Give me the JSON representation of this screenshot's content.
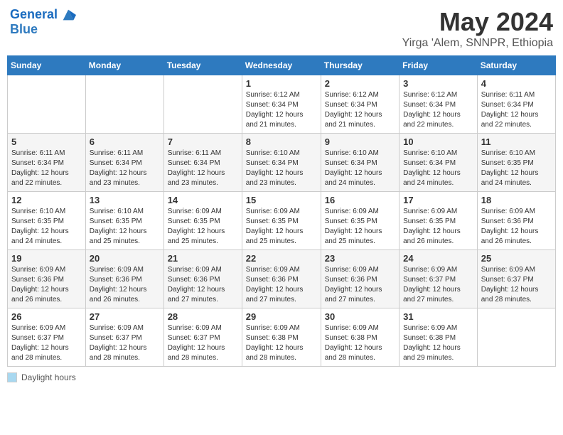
{
  "header": {
    "logo_line1": "General",
    "logo_line2": "Blue",
    "month": "May 2024",
    "location": "Yirga 'Alem, SNNPR, Ethiopia"
  },
  "days_of_week": [
    "Sunday",
    "Monday",
    "Tuesday",
    "Wednesday",
    "Thursday",
    "Friday",
    "Saturday"
  ],
  "weeks": [
    [
      {
        "day": "",
        "info": ""
      },
      {
        "day": "",
        "info": ""
      },
      {
        "day": "",
        "info": ""
      },
      {
        "day": "1",
        "info": "Sunrise: 6:12 AM\nSunset: 6:34 PM\nDaylight: 12 hours\nand 21 minutes."
      },
      {
        "day": "2",
        "info": "Sunrise: 6:12 AM\nSunset: 6:34 PM\nDaylight: 12 hours\nand 21 minutes."
      },
      {
        "day": "3",
        "info": "Sunrise: 6:12 AM\nSunset: 6:34 PM\nDaylight: 12 hours\nand 22 minutes."
      },
      {
        "day": "4",
        "info": "Sunrise: 6:11 AM\nSunset: 6:34 PM\nDaylight: 12 hours\nand 22 minutes."
      }
    ],
    [
      {
        "day": "5",
        "info": "Sunrise: 6:11 AM\nSunset: 6:34 PM\nDaylight: 12 hours\nand 22 minutes."
      },
      {
        "day": "6",
        "info": "Sunrise: 6:11 AM\nSunset: 6:34 PM\nDaylight: 12 hours\nand 23 minutes."
      },
      {
        "day": "7",
        "info": "Sunrise: 6:11 AM\nSunset: 6:34 PM\nDaylight: 12 hours\nand 23 minutes."
      },
      {
        "day": "8",
        "info": "Sunrise: 6:10 AM\nSunset: 6:34 PM\nDaylight: 12 hours\nand 23 minutes."
      },
      {
        "day": "9",
        "info": "Sunrise: 6:10 AM\nSunset: 6:34 PM\nDaylight: 12 hours\nand 24 minutes."
      },
      {
        "day": "10",
        "info": "Sunrise: 6:10 AM\nSunset: 6:34 PM\nDaylight: 12 hours\nand 24 minutes."
      },
      {
        "day": "11",
        "info": "Sunrise: 6:10 AM\nSunset: 6:35 PM\nDaylight: 12 hours\nand 24 minutes."
      }
    ],
    [
      {
        "day": "12",
        "info": "Sunrise: 6:10 AM\nSunset: 6:35 PM\nDaylight: 12 hours\nand 24 minutes."
      },
      {
        "day": "13",
        "info": "Sunrise: 6:10 AM\nSunset: 6:35 PM\nDaylight: 12 hours\nand 25 minutes."
      },
      {
        "day": "14",
        "info": "Sunrise: 6:09 AM\nSunset: 6:35 PM\nDaylight: 12 hours\nand 25 minutes."
      },
      {
        "day": "15",
        "info": "Sunrise: 6:09 AM\nSunset: 6:35 PM\nDaylight: 12 hours\nand 25 minutes."
      },
      {
        "day": "16",
        "info": "Sunrise: 6:09 AM\nSunset: 6:35 PM\nDaylight: 12 hours\nand 25 minutes."
      },
      {
        "day": "17",
        "info": "Sunrise: 6:09 AM\nSunset: 6:35 PM\nDaylight: 12 hours\nand 26 minutes."
      },
      {
        "day": "18",
        "info": "Sunrise: 6:09 AM\nSunset: 6:36 PM\nDaylight: 12 hours\nand 26 minutes."
      }
    ],
    [
      {
        "day": "19",
        "info": "Sunrise: 6:09 AM\nSunset: 6:36 PM\nDaylight: 12 hours\nand 26 minutes."
      },
      {
        "day": "20",
        "info": "Sunrise: 6:09 AM\nSunset: 6:36 PM\nDaylight: 12 hours\nand 26 minutes."
      },
      {
        "day": "21",
        "info": "Sunrise: 6:09 AM\nSunset: 6:36 PM\nDaylight: 12 hours\nand 27 minutes."
      },
      {
        "day": "22",
        "info": "Sunrise: 6:09 AM\nSunset: 6:36 PM\nDaylight: 12 hours\nand 27 minutes."
      },
      {
        "day": "23",
        "info": "Sunrise: 6:09 AM\nSunset: 6:36 PM\nDaylight: 12 hours\nand 27 minutes."
      },
      {
        "day": "24",
        "info": "Sunrise: 6:09 AM\nSunset: 6:37 PM\nDaylight: 12 hours\nand 27 minutes."
      },
      {
        "day": "25",
        "info": "Sunrise: 6:09 AM\nSunset: 6:37 PM\nDaylight: 12 hours\nand 28 minutes."
      }
    ],
    [
      {
        "day": "26",
        "info": "Sunrise: 6:09 AM\nSunset: 6:37 PM\nDaylight: 12 hours\nand 28 minutes."
      },
      {
        "day": "27",
        "info": "Sunrise: 6:09 AM\nSunset: 6:37 PM\nDaylight: 12 hours\nand 28 minutes."
      },
      {
        "day": "28",
        "info": "Sunrise: 6:09 AM\nSunset: 6:37 PM\nDaylight: 12 hours\nand 28 minutes."
      },
      {
        "day": "29",
        "info": "Sunrise: 6:09 AM\nSunset: 6:38 PM\nDaylight: 12 hours\nand 28 minutes."
      },
      {
        "day": "30",
        "info": "Sunrise: 6:09 AM\nSunset: 6:38 PM\nDaylight: 12 hours\nand 28 minutes."
      },
      {
        "day": "31",
        "info": "Sunrise: 6:09 AM\nSunset: 6:38 PM\nDaylight: 12 hours\nand 29 minutes."
      },
      {
        "day": "",
        "info": ""
      }
    ]
  ],
  "footer": {
    "legend_label": "Daylight hours"
  }
}
